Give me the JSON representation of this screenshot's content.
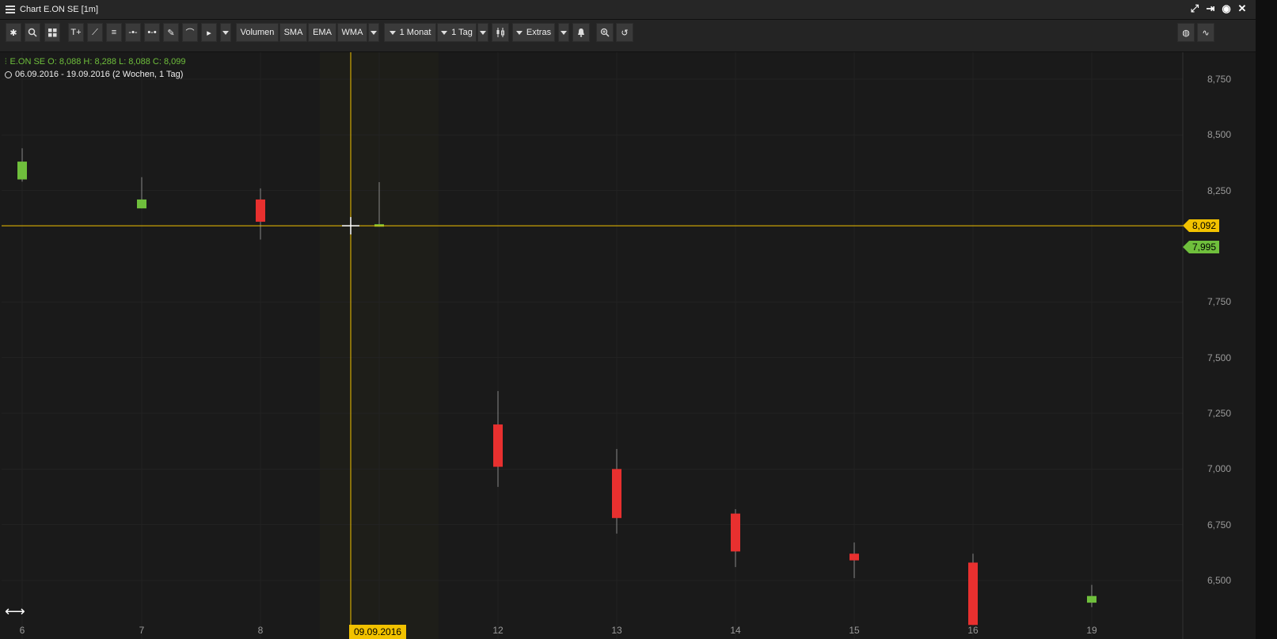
{
  "window": {
    "title": "Chart E.ON SE [1m]"
  },
  "toolbar": {
    "volumen": "Volumen",
    "sma": "SMA",
    "ema": "EMA",
    "wma": "WMA",
    "range": "1 Monat",
    "interval": "1 Tag",
    "extras": "Extras"
  },
  "info": {
    "ohlc": "E.ON SE  O: 8,088  H: 8,288  L: 8,088  C: 8,099",
    "range": "06.09.2016 - 19.09.2016   (2 Wochen, 1 Tag)"
  },
  "crosshair": {
    "price": "8,092",
    "date": "09.09.2016"
  },
  "last_price": "7,995",
  "colors": {
    "up": "#6fbf3c",
    "down": "#e8302f",
    "crosshair": "#f2c200"
  },
  "chart_data": {
    "type": "candlestick",
    "x_tick_labels": [
      "6",
      "7",
      "8",
      "12",
      "13",
      "14",
      "15",
      "16",
      "19"
    ],
    "y_tick_labels": [
      "8,750",
      "8,500",
      "8,250",
      "7,750",
      "7,500",
      "7,250",
      "7,000",
      "6,750",
      "6,500"
    ],
    "ylim": [
      6.35,
      8.85
    ],
    "candles": [
      {
        "x": "06.09.2016",
        "o": 8.3,
        "h": 8.44,
        "l": 8.29,
        "c": 8.38
      },
      {
        "x": "07.09.2016",
        "o": 8.17,
        "h": 8.31,
        "l": 8.17,
        "c": 8.21
      },
      {
        "x": "08.09.2016",
        "o": 8.21,
        "h": 8.26,
        "l": 8.03,
        "c": 8.11
      },
      {
        "x": "09.09.2016",
        "o": 8.088,
        "h": 8.288,
        "l": 8.088,
        "c": 8.099
      },
      {
        "x": "12.09.2016",
        "o": 7.2,
        "h": 7.35,
        "l": 6.92,
        "c": 7.01
      },
      {
        "x": "13.09.2016",
        "o": 7.0,
        "h": 7.09,
        "l": 6.71,
        "c": 6.78
      },
      {
        "x": "14.09.2016",
        "o": 6.8,
        "h": 6.82,
        "l": 6.56,
        "c": 6.63
      },
      {
        "x": "15.09.2016",
        "o": 6.62,
        "h": 6.67,
        "l": 6.51,
        "c": 6.59
      },
      {
        "x": "16.09.2016",
        "o": 6.58,
        "h": 6.62,
        "l": 6.3,
        "c": 6.3
      },
      {
        "x": "19.09.2016",
        "o": 6.4,
        "h": 6.48,
        "l": 6.38,
        "c": 6.43
      }
    ]
  }
}
